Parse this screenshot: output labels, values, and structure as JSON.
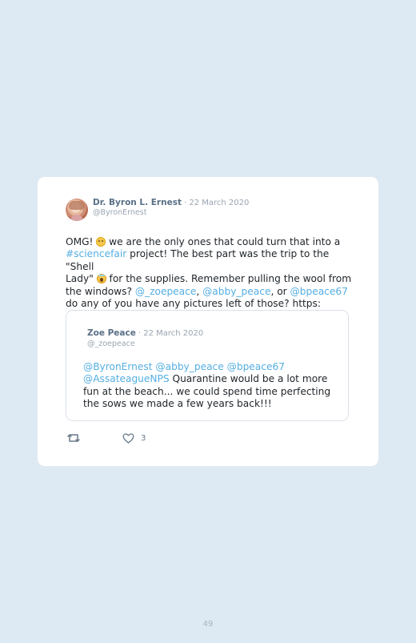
{
  "tweet": {
    "author": {
      "display_name": "Dr. Byron L. Ernest",
      "date": "· 22 March 2020",
      "handle": "@ByronErnest"
    },
    "text": {
      "line1_prefix": "OMG! ",
      "line1_suffix": " we are the only ones that could turn that into a",
      "hashtag": "#sciencefair",
      "line2_a": " project! The best part was the trip to the \"Shell",
      "line3_a": "Lady\" ",
      "line3_b": " for the supplies. Remember pulling the wool from",
      "line4_a": "the windows? ",
      "mention1": "@_zoepeace",
      "comma1": ", ",
      "mention2": "@abby_peace",
      "comma2": ", or ",
      "mention3": "@bpeace67",
      "line5": "do any of you have any pictures left of those? https:"
    },
    "quote": {
      "author": {
        "display_name": "Zoe Peace",
        "date": "· 22 March 2020",
        "handle": "@_zoepeace"
      },
      "text": {
        "mention1": "@ByronErnest",
        "mention2": "@abby_peace",
        "mention3": "@bpeace67",
        "mention4": "@AssateagueNPS",
        "line2_suffix": " Quarantine would be a lot more",
        "line3": "fun at the beach... we could spend time perfecting",
        "line4": "the sows we made a few years back!!!"
      }
    },
    "actions": {
      "retweet_icon": "retweet-icon",
      "like_icon": "heart-icon",
      "like_count": "3"
    }
  },
  "page": {
    "number": "49"
  },
  "colors": {
    "background": "#deeaf3",
    "card": "#ffffff",
    "link": "#54aee2",
    "name": "#596f86",
    "muted": "#9aa5b1"
  }
}
